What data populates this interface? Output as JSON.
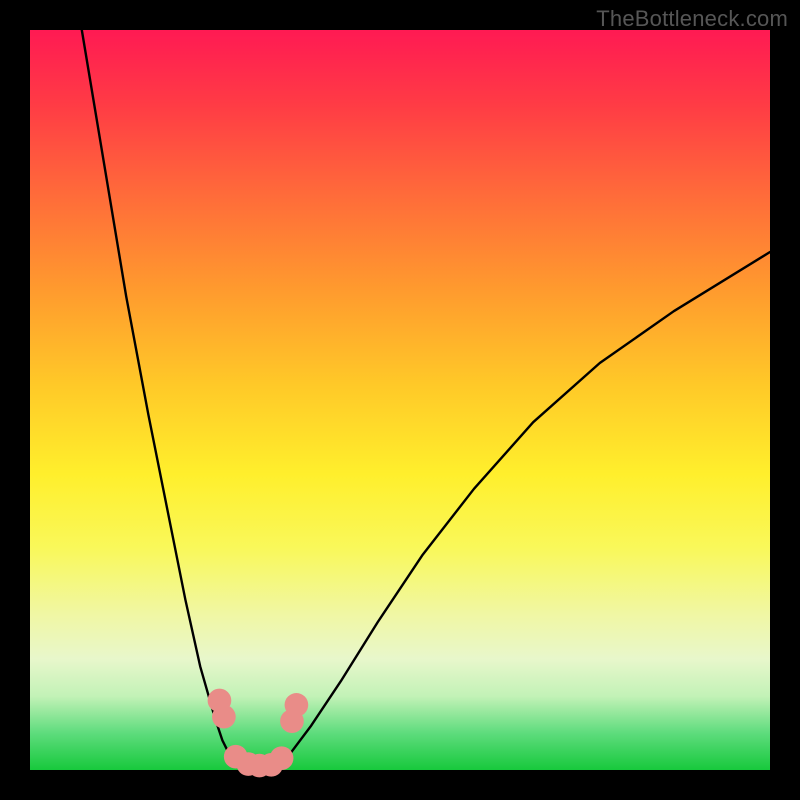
{
  "watermark": "TheBottleneck.com",
  "chart_data": {
    "type": "line",
    "title": "",
    "xlabel": "",
    "ylabel": "",
    "xlim": [
      0,
      100
    ],
    "ylim": [
      0,
      100
    ],
    "grid": false,
    "annotations": [],
    "background_gradient": {
      "top": "#ff1a53",
      "upper_mid": "#ffc928",
      "lower_mid": "#f9f85a",
      "bottom": "#17c93c",
      "meaning": "red=high bottleneck, green=low bottleneck"
    },
    "series": [
      {
        "name": "left-curve",
        "color": "#000000",
        "x": [
          7,
          10,
          13,
          16,
          19,
          21,
          23,
          25,
          26,
          27,
          28,
          29
        ],
        "y": [
          100,
          82,
          64,
          48,
          33,
          23,
          14,
          7,
          4,
          2,
          1,
          0
        ]
      },
      {
        "name": "right-curve",
        "color": "#000000",
        "x": [
          33,
          35,
          38,
          42,
          47,
          53,
          60,
          68,
          77,
          87,
          100
        ],
        "y": [
          0,
          2,
          6,
          12,
          20,
          29,
          38,
          47,
          55,
          62,
          70
        ]
      },
      {
        "name": "valley-floor",
        "color": "#000000",
        "x": [
          29,
          31,
          33
        ],
        "y": [
          0,
          0,
          0
        ]
      }
    ],
    "markers": [
      {
        "name": "left-upper-dot",
        "x": 25.6,
        "y": 9.4,
        "color": "#e98c88",
        "r": 1.6
      },
      {
        "name": "left-lower-dot",
        "x": 26.2,
        "y": 7.2,
        "color": "#e98c88",
        "r": 1.6
      },
      {
        "name": "left-bottom-dot",
        "x": 27.8,
        "y": 1.8,
        "color": "#e98c88",
        "r": 1.6
      },
      {
        "name": "floor-dot-1",
        "x": 29.5,
        "y": 0.8,
        "color": "#e98c88",
        "r": 1.6
      },
      {
        "name": "floor-dot-2",
        "x": 31.0,
        "y": 0.6,
        "color": "#e98c88",
        "r": 1.6
      },
      {
        "name": "floor-dot-3",
        "x": 32.6,
        "y": 0.7,
        "color": "#e98c88",
        "r": 1.6
      },
      {
        "name": "right-bottom-dot",
        "x": 34.0,
        "y": 1.6,
        "color": "#e98c88",
        "r": 1.6
      },
      {
        "name": "right-lower-dot",
        "x": 35.4,
        "y": 6.6,
        "color": "#e98c88",
        "r": 1.6
      },
      {
        "name": "right-upper-dot",
        "x": 36.0,
        "y": 8.8,
        "color": "#e98c88",
        "r": 1.6
      }
    ]
  }
}
